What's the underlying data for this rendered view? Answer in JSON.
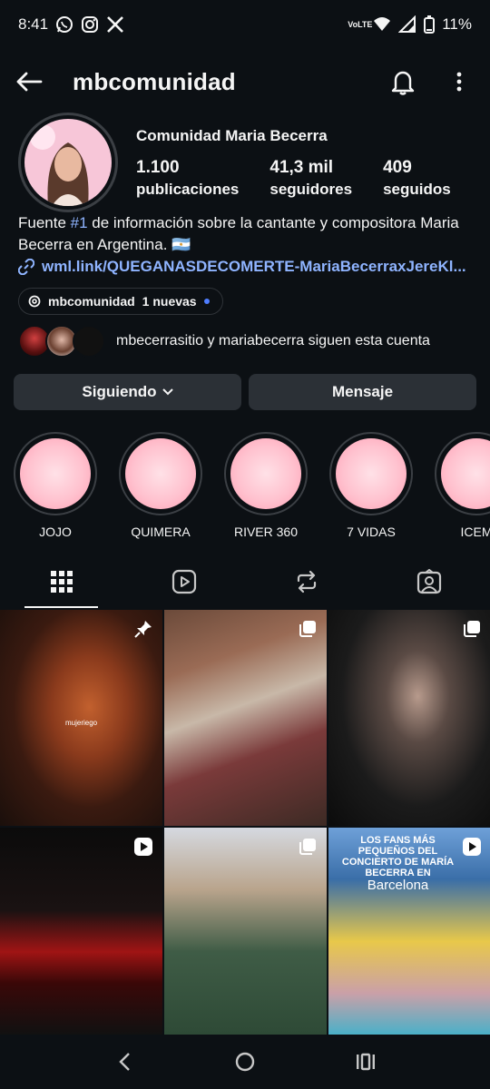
{
  "status_bar": {
    "time": "8:41",
    "network": "VoLTE",
    "battery": "11%"
  },
  "header": {
    "username": "mbcomunidad"
  },
  "profile": {
    "display_name": "Comunidad Maria Becerra",
    "stats": [
      {
        "value": "1.100",
        "label": "publicaciones"
      },
      {
        "value": "41,3 mil",
        "label": "seguidores"
      },
      {
        "value": "409",
        "label": "seguidos"
      }
    ],
    "bio_prefix": "Fuente ",
    "bio_hashtag": "#1",
    "bio_suffix": " de información sobre la cantante y compositora Maria Becerra en Argentina. 🇦🇷",
    "link": "wml.link/QUEGANASDECOMERTE-MariaBecerraxJereKl...",
    "threads_handle": "mbcomunidad",
    "threads_new": "1 nuevas",
    "followed_by": "mbecerrasitio y mariabecerra siguen esta cuenta"
  },
  "buttons": {
    "following": "Siguiendo",
    "message": "Mensaje"
  },
  "highlights": [
    {
      "label": "JOJO"
    },
    {
      "label": "QUIMERA"
    },
    {
      "label": "RIVER 360"
    },
    {
      "label": "7 VIDAS"
    },
    {
      "label": "ICEM"
    }
  ],
  "posts": {
    "tile1_watermark": "mujeriego",
    "tile6_caption": "LOS FANS MÁS PEQUEÑOS DEL CONCIERTO DE MARÍA BECERRA EN",
    "tile6_caption_big": "Barcelona"
  },
  "colors": {
    "background": "#0c1014",
    "button": "#2b3036",
    "link": "#8fb4ff"
  }
}
